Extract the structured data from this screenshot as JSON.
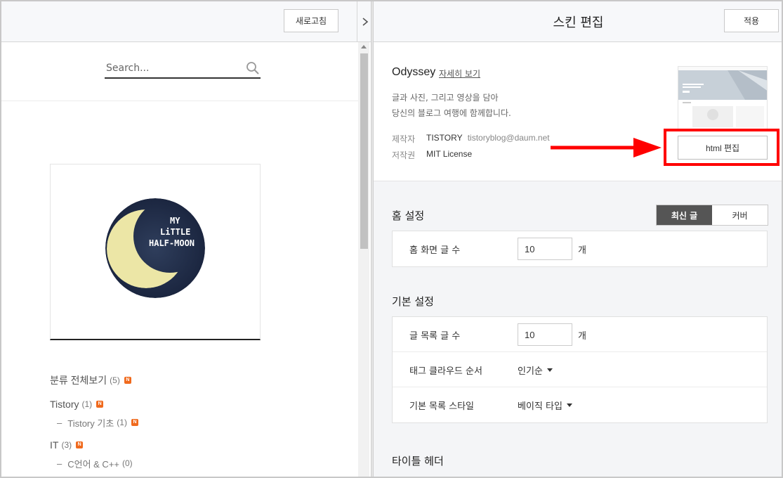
{
  "left": {
    "refresh_label": "새로고침",
    "toggle_icon": "chevron-right",
    "search_placeholder": "Search...",
    "avatar_text": [
      "MY",
      "LiTTLE",
      "HALF-MOON"
    ],
    "categories": [
      {
        "label": "분류 전체보기",
        "count": "(5)",
        "badge": "N"
      },
      {
        "label": "Tistory",
        "count": "(1)",
        "badge": "N"
      },
      {
        "label": "Tistory 기초",
        "count": "(1)",
        "badge": "N",
        "sub": true
      },
      {
        "label": "IT",
        "count": "(3)",
        "badge": "N"
      },
      {
        "label": "C언어 & C++",
        "count": "(0)",
        "sub": true
      }
    ]
  },
  "right": {
    "title": "스킨 편집",
    "apply_label": "적용",
    "skin": {
      "name": "Odyssey",
      "detail_link": "자세히 보기",
      "desc_line1": "글과 사진, 그리고 영상을 담아",
      "desc_line2": "당신의 블로그 여행에 함께합니다.",
      "author_label": "제작자",
      "author": "TISTORY",
      "email": "tistoryblog@daum.net",
      "license_label": "저작권",
      "license": "MIT License",
      "html_edit_label": "html 편집"
    },
    "home": {
      "title": "홈 설정",
      "tab_latest": "최신 글",
      "tab_cover": "커버",
      "count_label": "홈 화면 글 수",
      "count_value": "10",
      "unit": "개"
    },
    "basic": {
      "title": "기본 설정",
      "list_count_label": "글 목록 글 수",
      "list_count_value": "10",
      "unit": "개",
      "tag_cloud_label": "태그 클라우드 순서",
      "tag_cloud_value": "인기순",
      "list_style_label": "기본 목록 스타일",
      "list_style_value": "베이직 타입"
    },
    "title_header": {
      "title": "타이틀 헤더"
    }
  },
  "colors": {
    "annotation": "#ff0000",
    "accent_tab": "#555555",
    "new_badge": "#f06a1d"
  }
}
